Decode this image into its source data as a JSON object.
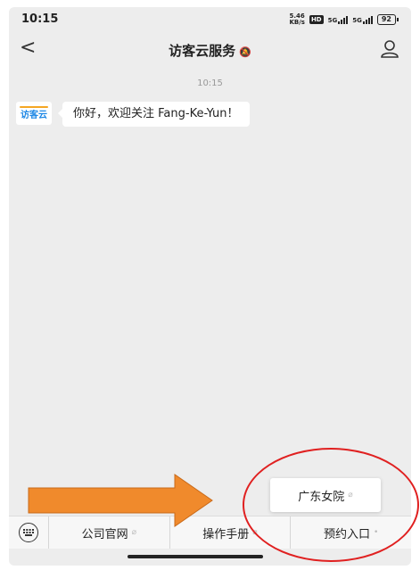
{
  "status_bar": {
    "time": "10:15",
    "net_speed_value": "5.46",
    "net_speed_unit": "KB/s",
    "hd_label": "HD",
    "signal_1": "5G",
    "signal_2": "5G",
    "battery": "92"
  },
  "header": {
    "title": "访客云服务",
    "back_icon": "chevron-left-icon",
    "mute_icon": "mute-bell-icon",
    "profile_icon": "person-icon"
  },
  "chat": {
    "timestamp": "10:15",
    "avatar_text": "访客云",
    "message": "你好，欢迎关注 Fang-Ke-Yun！"
  },
  "popup_menu": {
    "item": "广东女院"
  },
  "menu": {
    "items": [
      {
        "label": "公司官网"
      },
      {
        "label": "操作手册"
      },
      {
        "label": "预约入口"
      }
    ]
  },
  "annotations": {
    "arrow_color": "#f08a2c",
    "circle_color": "#e02020"
  }
}
